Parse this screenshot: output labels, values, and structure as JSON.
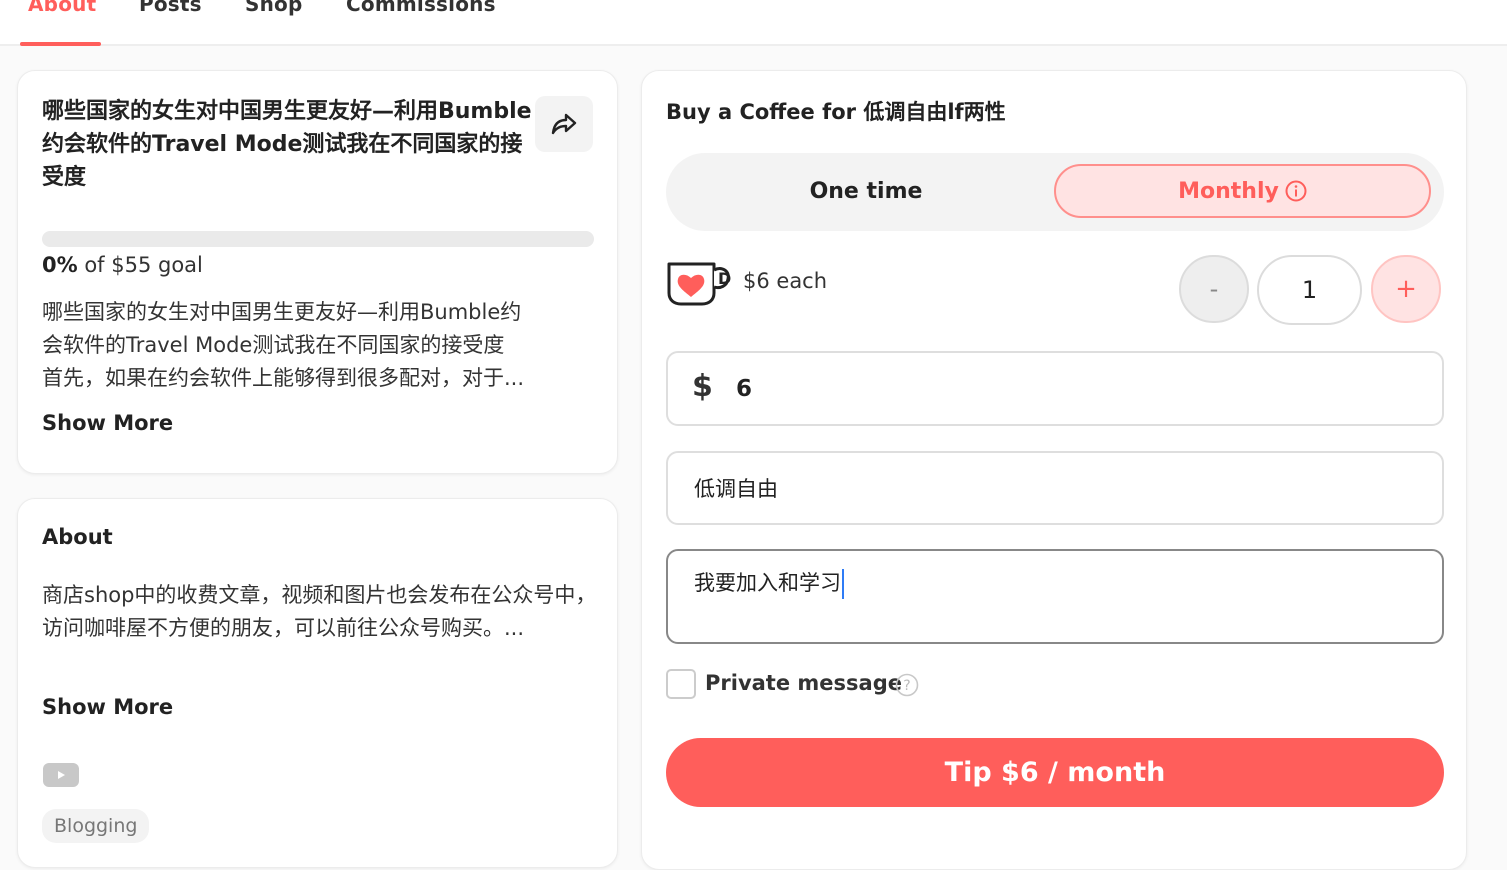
{
  "tabs": [
    {
      "label": "About",
      "active": true
    },
    {
      "label": "Posts",
      "active": false
    },
    {
      "label": "Shop",
      "active": false
    },
    {
      "label": "Commissions",
      "active": false
    }
  ],
  "goal": {
    "title": "哪些国家的女生对中国男生更友好—利用Bumble约会软件的Travel Mode测试我在不同国家的接受度",
    "percent": "0%",
    "goal_suffix": " of $55 goal",
    "progress_fraction": 0,
    "description_lines": [
      "哪些国家的女生对中国男生更友好—利用Bumble约",
      "会软件的Travel Mode测试我在不同国家的接受度",
      "首先，如果在约会软件上能够得到很多配对，对于..."
    ],
    "show_more": "Show More",
    "share_icon": "share-icon"
  },
  "about": {
    "heading": "About",
    "text": "商店shop中的收费文章，视频和图片也会发布在公众号中，访问咖啡屋不方便的朋友，可以前往公众号购买。...",
    "show_more": "Show More",
    "social_icon": "youtube-icon",
    "tag": "Blogging"
  },
  "coffee": {
    "title": "Buy a Coffee for 低调自由lf两性",
    "one_time": "One time",
    "monthly": "Monthly",
    "selected_frequency": "Monthly",
    "price_each": "$6 each",
    "minus": "-",
    "quantity": "1",
    "plus": "+",
    "currency": "$",
    "amount": "6",
    "name_value": "低调自由",
    "message_value": "我要加入和学习",
    "private_label": "Private message",
    "tip_button": "Tip $6 / month"
  },
  "colors": {
    "accent": "#ff5e5b",
    "accent_light": "#ffe3e3"
  }
}
